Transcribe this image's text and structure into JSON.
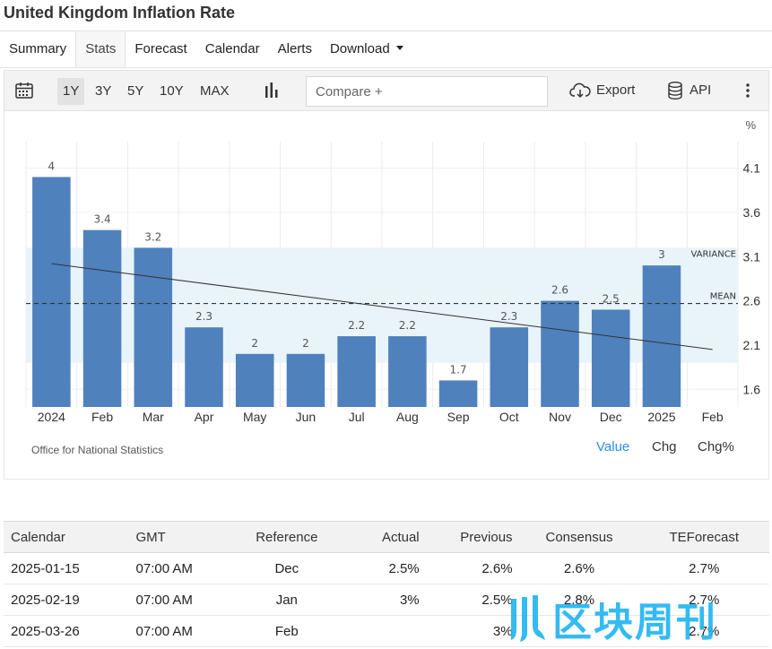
{
  "title": "United Kingdom Inflation Rate",
  "tabs": [
    {
      "label": "Summary",
      "active": false
    },
    {
      "label": "Stats",
      "active": true
    },
    {
      "label": "Forecast",
      "active": false
    },
    {
      "label": "Calendar",
      "active": false
    },
    {
      "label": "Alerts",
      "active": false
    },
    {
      "label": "Download",
      "active": false,
      "dropdown": true
    }
  ],
  "toolbar": {
    "calendar_icon": "calendar-icon",
    "ranges": [
      "1Y",
      "3Y",
      "5Y",
      "10Y",
      "MAX"
    ],
    "active_range": "1Y",
    "chart_type_icon": "bar-chart-icon",
    "compare_placeholder": "Compare +",
    "export_label": "Export",
    "export_icon": "cloud-download-icon",
    "api_label": "API",
    "api_icon": "database-icon",
    "more_icon": "more-vertical-icon"
  },
  "chart_data": {
    "type": "bar",
    "categories": [
      "2024",
      "Feb",
      "Mar",
      "Apr",
      "May",
      "Jun",
      "Jul",
      "Aug",
      "Sep",
      "Oct",
      "Nov",
      "Dec",
      "2025",
      "Feb"
    ],
    "values": [
      4,
      3.4,
      3.2,
      2.3,
      2,
      2,
      2.2,
      2.2,
      1.7,
      2.3,
      2.6,
      2.5,
      3,
      null
    ],
    "data_labels": [
      "4",
      "3.4",
      "3.2",
      "2.3",
      "2",
      "2",
      "2.2",
      "2.2",
      "1.7",
      "2.3",
      "2.6",
      "2.5",
      "3"
    ],
    "unit": "%",
    "y_ticks": [
      "4.1",
      "3.6",
      "3.1",
      "2.6",
      "2.1",
      "1.6"
    ],
    "ylim": [
      1.4,
      4.4
    ],
    "mean": 2.57,
    "mean_label": "MEAN",
    "variance_band": [
      1.9,
      3.2
    ],
    "variance_label": "VARIANCE",
    "trend_line": [
      3.02,
      2.05
    ],
    "bar_color": "#4f81bd",
    "band_color": "#e8f3fa",
    "grid": true
  },
  "source": "Office for National Statistics",
  "chart_modes": [
    {
      "label": "Value",
      "active": true
    },
    {
      "label": "Chg",
      "active": false
    },
    {
      "label": "Chg%",
      "active": false
    }
  ],
  "calendar": {
    "headers": [
      "Calendar",
      "GMT",
      "Reference",
      "Actual",
      "Previous",
      "Consensus",
      "TEForecast"
    ],
    "rows": [
      [
        "2025-01-15",
        "07:00 AM",
        "Dec",
        "2.5%",
        "2.6%",
        "2.6%",
        "2.7%"
      ],
      [
        "2025-02-19",
        "07:00 AM",
        "Jan",
        "3%",
        "2.5%",
        "2.8%",
        "2.7%"
      ],
      [
        "2025-03-26",
        "07:00 AM",
        "Feb",
        "",
        "3%",
        "",
        "2.7%"
      ]
    ]
  },
  "watermark": {
    "text": "区块周刊"
  },
  "colors": {
    "accent": "#2d8ce5",
    "watermark": "#1fb4f0"
  }
}
